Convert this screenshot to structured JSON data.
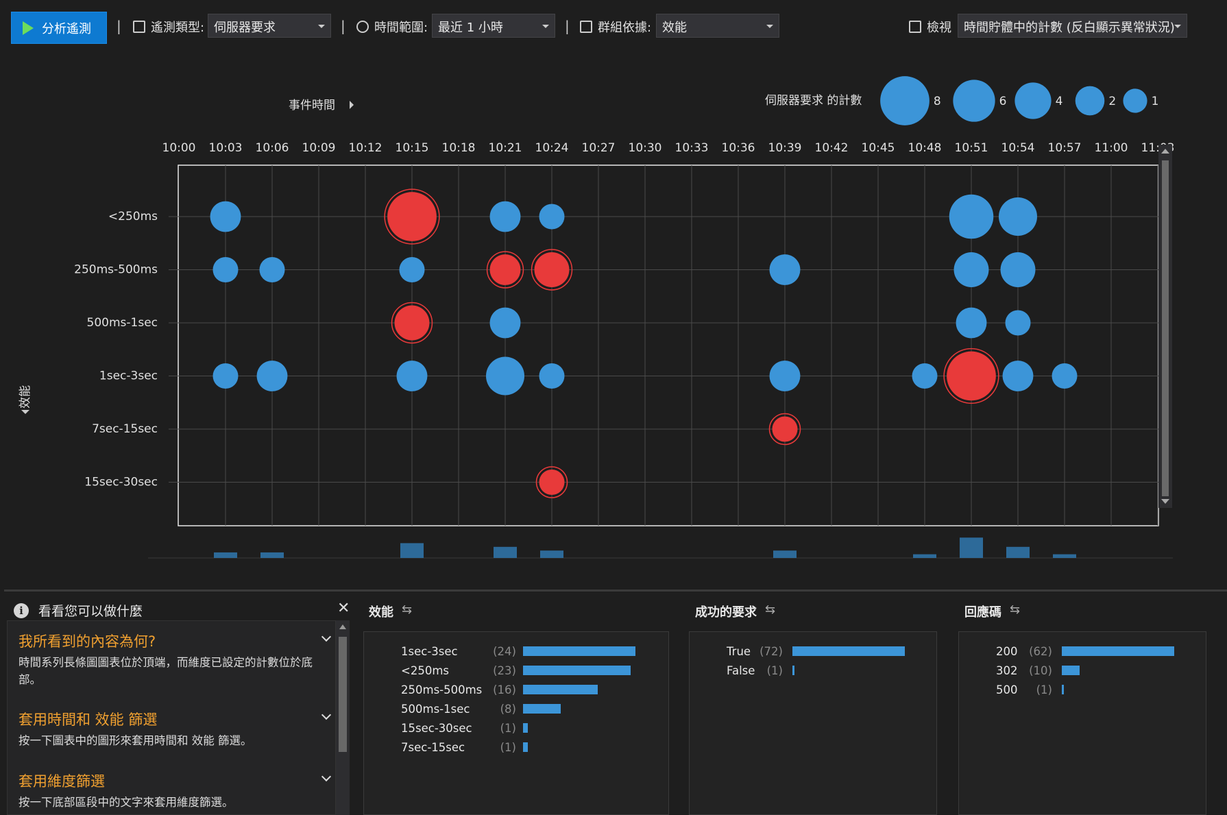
{
  "toolbar": {
    "analyze_label": "分析遙測",
    "telemetry_type_label": "遙測類型:",
    "telemetry_type_value": "伺服器要求",
    "time_range_label": "時間範圍:",
    "time_range_value": "最近 1 小時",
    "group_by_label": "群組依據:",
    "group_by_value": "效能",
    "view_label": "檢視",
    "view_value": "時間貯體中的計數 (反白顯示異常狀況)"
  },
  "chart": {
    "x_axis_toggle": "事件時間",
    "y_axis_toggle": "效能",
    "legend_title": "伺服器要求 的計數",
    "legend_sizes": [
      8,
      6,
      4,
      2,
      1
    ],
    "colors": {
      "normal": "#3c95d8",
      "anomaly": "#e83a3a"
    }
  },
  "chart_data": {
    "type": "scatter",
    "x_ticks": [
      "10:00",
      "10:03",
      "10:06",
      "10:09",
      "10:12",
      "10:15",
      "10:18",
      "10:21",
      "10:24",
      "10:27",
      "10:30",
      "10:33",
      "10:36",
      "10:39",
      "10:42",
      "10:45",
      "10:48",
      "10:51",
      "10:54",
      "10:57",
      "11:00",
      "11:03"
    ],
    "y_categories": [
      "<250ms",
      "250ms-500ms",
      "500ms-1sec",
      "1sec-3sec",
      "7sec-15sec",
      "15sec-30sec"
    ],
    "points": [
      {
        "x": "10:03",
        "y": "<250ms",
        "count": 2,
        "anomaly": false
      },
      {
        "x": "10:15",
        "y": "<250ms",
        "count": 8,
        "anomaly": true
      },
      {
        "x": "10:21",
        "y": "<250ms",
        "count": 2,
        "anomaly": false
      },
      {
        "x": "10:24",
        "y": "<250ms",
        "count": 1,
        "anomaly": false
      },
      {
        "x": "10:51",
        "y": "<250ms",
        "count": 6,
        "anomaly": false
      },
      {
        "x": "10:54",
        "y": "<250ms",
        "count": 4,
        "anomaly": false
      },
      {
        "x": "10:03",
        "y": "250ms-500ms",
        "count": 1,
        "anomaly": false
      },
      {
        "x": "10:06",
        "y": "250ms-500ms",
        "count": 1,
        "anomaly": false
      },
      {
        "x": "10:15",
        "y": "250ms-500ms",
        "count": 1,
        "anomaly": false
      },
      {
        "x": "10:21",
        "y": "250ms-500ms",
        "count": 2,
        "anomaly": true
      },
      {
        "x": "10:24",
        "y": "250ms-500ms",
        "count": 3,
        "anomaly": true
      },
      {
        "x": "10:39",
        "y": "250ms-500ms",
        "count": 2,
        "anomaly": false
      },
      {
        "x": "10:51",
        "y": "250ms-500ms",
        "count": 3,
        "anomaly": false
      },
      {
        "x": "10:54",
        "y": "250ms-500ms",
        "count": 3,
        "anomaly": false
      },
      {
        "x": "10:15",
        "y": "500ms-1sec",
        "count": 3,
        "anomaly": true
      },
      {
        "x": "10:21",
        "y": "500ms-1sec",
        "count": 2,
        "anomaly": false
      },
      {
        "x": "10:51",
        "y": "500ms-1sec",
        "count": 2,
        "anomaly": false
      },
      {
        "x": "10:54",
        "y": "500ms-1sec",
        "count": 1,
        "anomaly": false
      },
      {
        "x": "10:03",
        "y": "1sec-3sec",
        "count": 1,
        "anomaly": false
      },
      {
        "x": "10:06",
        "y": "1sec-3sec",
        "count": 2,
        "anomaly": false
      },
      {
        "x": "10:15",
        "y": "1sec-3sec",
        "count": 2,
        "anomaly": false
      },
      {
        "x": "10:21",
        "y": "1sec-3sec",
        "count": 4,
        "anomaly": false
      },
      {
        "x": "10:24",
        "y": "1sec-3sec",
        "count": 1,
        "anomaly": false
      },
      {
        "x": "10:39",
        "y": "1sec-3sec",
        "count": 2,
        "anomaly": false
      },
      {
        "x": "10:48",
        "y": "1sec-3sec",
        "count": 1,
        "anomaly": false
      },
      {
        "x": "10:51",
        "y": "1sec-3sec",
        "count": 8,
        "anomaly": true
      },
      {
        "x": "10:54",
        "y": "1sec-3sec",
        "count": 2,
        "anomaly": false
      },
      {
        "x": "10:57",
        "y": "1sec-3sec",
        "count": 1,
        "anomaly": false
      },
      {
        "x": "10:39",
        "y": "7sec-15sec",
        "count": 1,
        "anomaly": true
      },
      {
        "x": "10:24",
        "y": "15sec-30sec",
        "count": 1,
        "anomaly": true
      }
    ],
    "histogram": [
      {
        "x": "10:03",
        "value": 3
      },
      {
        "x": "10:06",
        "value": 3
      },
      {
        "x": "10:15",
        "value": 8
      },
      {
        "x": "10:21",
        "value": 6
      },
      {
        "x": "10:24",
        "value": 4
      },
      {
        "x": "10:39",
        "value": 4
      },
      {
        "x": "10:48",
        "value": 2
      },
      {
        "x": "10:51",
        "value": 11
      },
      {
        "x": "10:54",
        "value": 6
      },
      {
        "x": "10:57",
        "value": 2
      }
    ]
  },
  "help": {
    "title": "看看您可以做什麼",
    "items": [
      {
        "title": "我所看到的內容為何?",
        "desc": "時間系列長條圖圖表位於頂端，而維度已設定的計數位於底部。"
      },
      {
        "title": "套用時間和 效能 篩選",
        "desc": "按一下圖表中的圖形來套用時間和 效能 篩選。"
      },
      {
        "title": "套用維度篩選",
        "desc": "按一下底部區段中的文字來套用維度篩選。"
      }
    ]
  },
  "dimensions": [
    {
      "title": "效能",
      "max": 24,
      "rows": [
        {
          "label": "1sec-3sec",
          "count": 24
        },
        {
          "label": "<250ms",
          "count": 23
        },
        {
          "label": "250ms-500ms",
          "count": 16
        },
        {
          "label": "500ms-1sec",
          "count": 8
        },
        {
          "label": "15sec-30sec",
          "count": 1
        },
        {
          "label": "7sec-15sec",
          "count": 1
        }
      ]
    },
    {
      "title": "成功的要求",
      "max": 72,
      "rows": [
        {
          "label": "True",
          "count": 72
        },
        {
          "label": "False",
          "count": 1
        }
      ]
    },
    {
      "title": "回應碼",
      "max": 62,
      "rows": [
        {
          "label": "200",
          "count": 62
        },
        {
          "label": "302",
          "count": 10
        },
        {
          "label": "500",
          "count": 1
        }
      ]
    }
  ]
}
